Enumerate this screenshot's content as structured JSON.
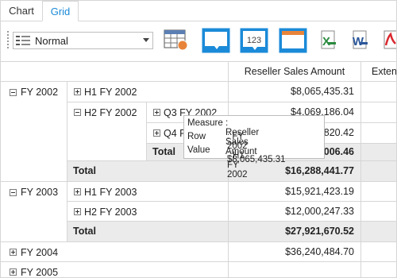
{
  "tabs": [
    {
      "label": "Chart"
    },
    {
      "label": "Grid",
      "active": true
    }
  ],
  "toolbar": {
    "layout_select": {
      "value": "Normal"
    },
    "buttons": [
      {
        "name": "grid-layout-icon"
      },
      {
        "name": "chart-type-icon"
      },
      {
        "name": "number-format-icon",
        "text": "123"
      },
      {
        "name": "window-icon"
      },
      {
        "name": "excel-export-icon",
        "text": "X"
      },
      {
        "name": "word-export-icon",
        "text": "W"
      },
      {
        "name": "pdf-export-icon"
      }
    ],
    "accent": "#1b8ad8"
  },
  "grid": {
    "headers": [
      "Reseller Sales Amount",
      "Exten"
    ],
    "rows": {
      "fy2002": {
        "label": "FY 2002"
      },
      "h1fy2002": {
        "label": "H1 FY 2002",
        "value": "$8,065,435.31"
      },
      "h2fy2002": {
        "label": "H2 FY 2002"
      },
      "q3fy2002": {
        "label": "Q3 FY 2002",
        "value": "$4,069,186.04"
      },
      "q4fy2002": {
        "label": "Q4 FY 2002",
        "value": "$4,153,820.42"
      },
      "h2total": {
        "label": "Total",
        "value": "$8,223,006.46"
      },
      "fy2002total": {
        "label": "Total",
        "value": "$16,288,441.77"
      },
      "fy2003": {
        "label": "FY 2003"
      },
      "h1fy2003": {
        "label": "H1 FY 2003",
        "value": "$15,921,423.19"
      },
      "h2fy2003": {
        "label": "H2 FY 2003",
        "value": "$12,000,247.33"
      },
      "fy2003total": {
        "label": "Total",
        "value": "$27,921,670.52"
      },
      "fy2004": {
        "label": "FY 2004",
        "value": "$36,240,484.70"
      },
      "fy2005": {
        "label": "FY 2005"
      }
    }
  },
  "tooltip": {
    "measure_key": "Measure",
    "measure_val": ": Reseller Sales Amount",
    "row_key": "Row",
    "row_val": ": FY 2002 - H1 FY 2002",
    "value_key": "Value",
    "value_val": ": $8,065,435.31"
  }
}
